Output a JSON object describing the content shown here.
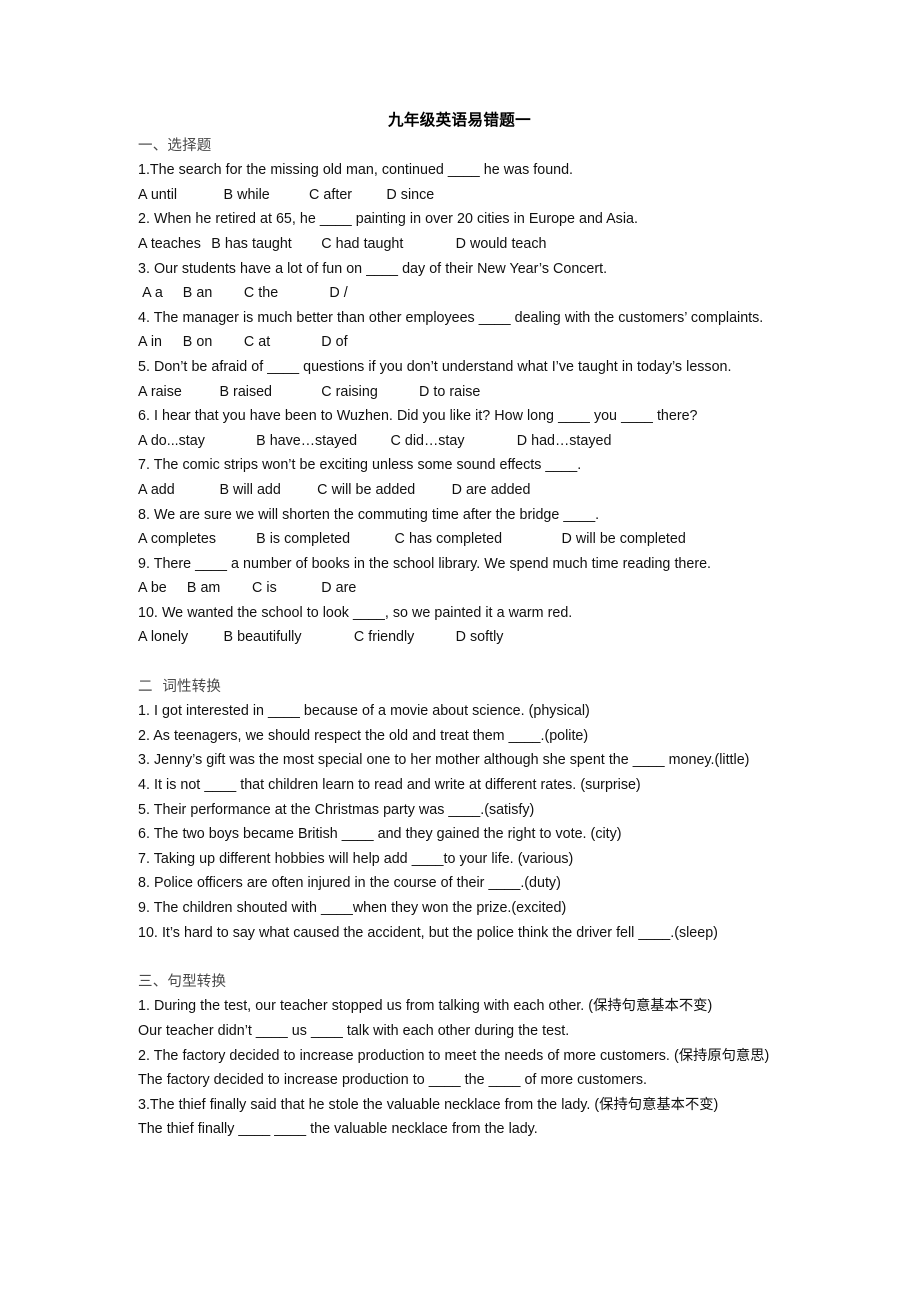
{
  "document": {
    "title": "九年级英语易错题一"
  },
  "sections": [
    {
      "heading": "一、选择题",
      "lines": [
        {
          "text": "1.The search for the missing old man, continued ____ he was found."
        },
        {
          "text": "A until\t     B while\t  C after\t     D since"
        },
        {
          "text": "2. When he retired at 65, he ____ painting in over 20 cities in Europe and Asia."
        },
        {
          "text": "A teaches\t  B has taught\t     C had taught\t      D would teach"
        },
        {
          "text": "3. Our students have a lot of fun on ____ day of their New Year’s Concert."
        },
        {
          "text": " A a\t   B an\t  C the\t       D /"
        },
        {
          "text": "4. The manager is much better than other employees ____ dealing with the customers’ complaints.",
          "justify": true
        },
        {
          "text": "A in\t   B on\t  C at\t     D of"
        },
        {
          "text": "5. Don’t be afraid of ____ questions if you don’t understand what I’ve taught in today’s lesson."
        },
        {
          "text": "A raise\t    B raised\t     C raising\t     D to raise"
        },
        {
          "text": "6. I hear that you have been to Wuzhen. Did you like it? How long ____ you ____ there?"
        },
        {
          "text": "A do...stay\t     B have…stayed\t      C did…stay\t     D had…stayed"
        },
        {
          "text": "7. The comic strips won’t be exciting unless some sound effects ____."
        },
        {
          "text": "A add\t    B will add\t    C will be added\t     D are added"
        },
        {
          "text": "8. We are sure we will shorten the commuting time after the bridge ____."
        },
        {
          "text": "A completes\t     B is completed\t       C has completed\t        D will be completed"
        },
        {
          "text": "9. There ____ a number of books in the school library. We spend much time reading there."
        },
        {
          "text": "A be\t    B am\t    C is\t     D are"
        },
        {
          "text": "10. We wanted the school to look ____, so we painted it a warm red."
        },
        {
          "text": "A lonely\t     B beautifully\t     C friendly\t      D softly"
        }
      ]
    },
    {
      "heading": "二  词性转换",
      "lines": [
        {
          "text": "1. I got interested in ____ because of a movie about science. (physical)"
        },
        {
          "text": "2. As teenagers, we should respect the old and treat them ____.(polite)"
        },
        {
          "text": "3. Jenny’s gift was the most special one to her mother although she spent the ____ money.(little)"
        },
        {
          "text": "4. It is not ____ that children learn to read and write at different rates. (surprise)"
        },
        {
          "text": "5. Their performance at the Christmas party was ____.(satisfy)"
        },
        {
          "text": "6. The two boys became British ____ and they gained the right to vote. (city)"
        },
        {
          "text": "7. Taking up different hobbies will help add ____to your life. (various)"
        },
        {
          "text": "8. Police officers are often injured in the course of their ____.(duty)"
        },
        {
          "text": "9. The children shouted with ____when they won the prize.(excited)"
        },
        {
          "text": "10. It’s hard to say what caused the accident, but the police think the driver fell ____.(sleep)"
        }
      ]
    },
    {
      "heading": "三、句型转换",
      "lines": [
        {
          "text": "1. During the test, our teacher stopped us from talking with each other. (保持句意基本不变)"
        },
        {
          "text": "Our teacher didn’t ____ us ____ talk with each other during the test."
        },
        {
          "text": "2. The factory decided to increase production to meet the needs of more customers. (保持原句意思)"
        },
        {
          "text": "The factory decided to increase production to ____ the ____ of more customers."
        },
        {
          "text": "3.The thief finally said that he stole the valuable necklace from the lady. (保持句意基本不变)"
        },
        {
          "text": "The thief finally ____ ____ the valuable necklace from the lady."
        }
      ]
    }
  ]
}
